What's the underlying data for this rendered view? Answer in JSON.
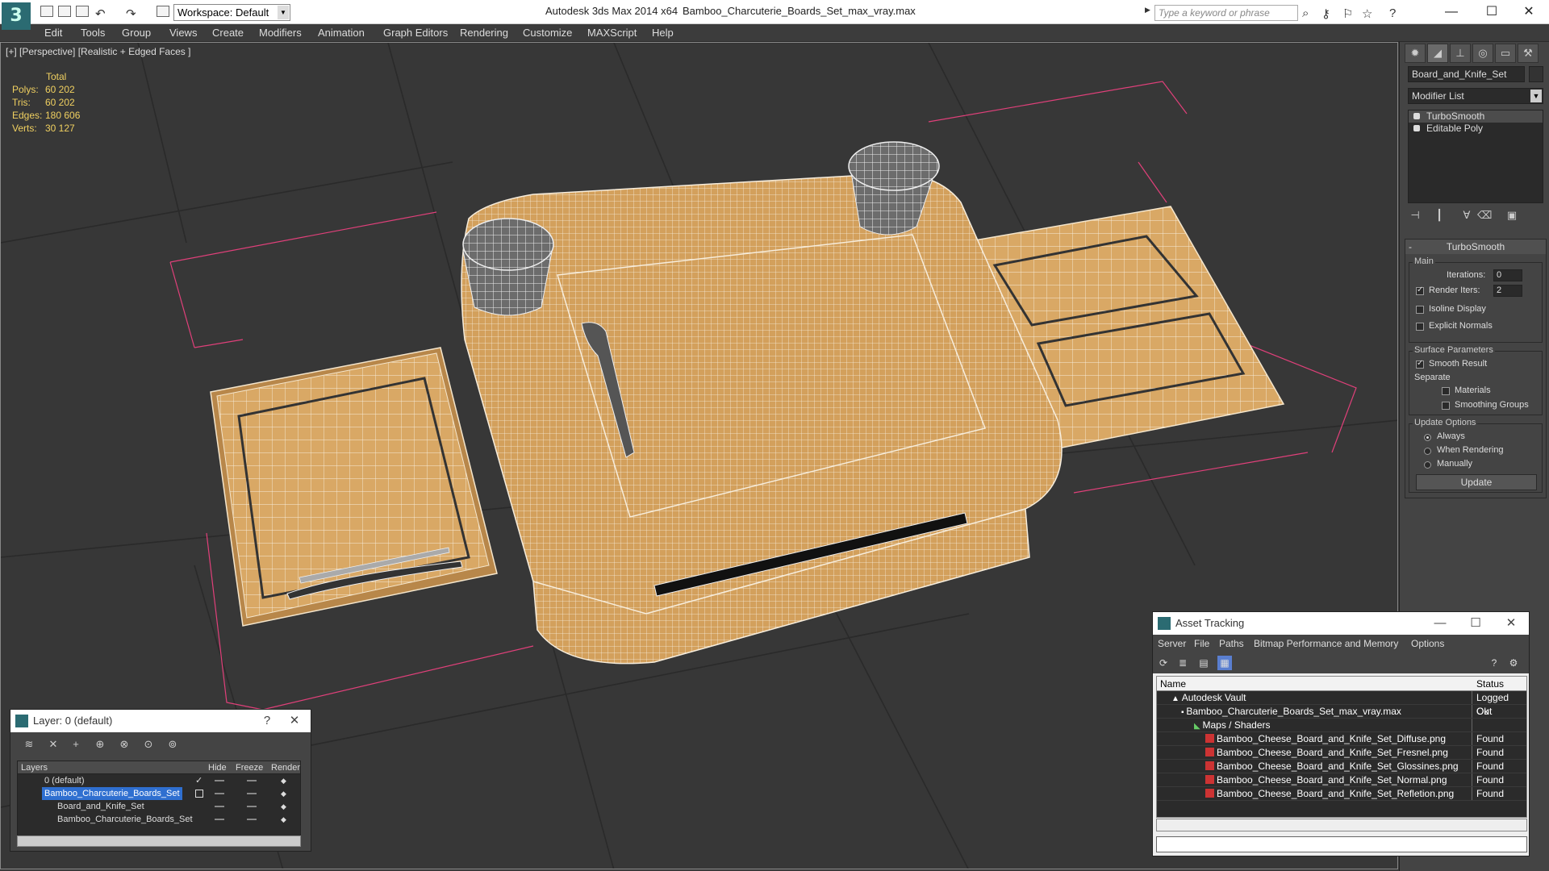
{
  "titlebar": {
    "workspace": "Workspace: Default",
    "app_title": "Autodesk 3ds Max  2014 x64",
    "file_title": "Bamboo_Charcuterie_Boards_Set_max_vray.max",
    "search_placeholder": "Type a keyword or phrase"
  },
  "menu": [
    "Edit",
    "Tools",
    "Group",
    "Views",
    "Create",
    "Modifiers",
    "Animation",
    "Graph Editors",
    "Rendering",
    "Customize",
    "MAXScript",
    "Help"
  ],
  "viewport": {
    "label": "[+] [Perspective] [Realistic + Edged Faces ]",
    "stats": {
      "header": "Total",
      "rows": [
        {
          "label": "Polys:",
          "value": "60 202"
        },
        {
          "label": "Tris:",
          "value": "60 202"
        },
        {
          "label": "Edges:",
          "value": "180 606"
        },
        {
          "label": "Verts:",
          "value": "30 127"
        }
      ]
    }
  },
  "command_panel": {
    "object_name": "Board_and_Knife_Set",
    "modifier_list": "Modifier List",
    "stack": [
      "TurboSmooth",
      "Editable Poly"
    ],
    "rollout_title": "TurboSmooth",
    "main_group": "Main",
    "iterations_label": "Iterations:",
    "iterations_value": "0",
    "render_iters_label": "Render Iters:",
    "render_iters_value": "2",
    "isoline": "Isoline Display",
    "explicit_normals": "Explicit Normals",
    "surface_group": "Surface Parameters",
    "smooth_result": "Smooth Result",
    "separate": "Separate",
    "materials": "Materials",
    "smoothing_groups": "Smoothing Groups",
    "update_group": "Update Options",
    "always": "Always",
    "when_rendering": "When Rendering",
    "manually": "Manually",
    "update_button": "Update"
  },
  "layer_window": {
    "title": "Layer: 0 (default)",
    "help": "?",
    "columns": [
      "Layers",
      "Hide",
      "Freeze",
      "Render"
    ],
    "rows": [
      {
        "name": "0 (default)"
      },
      {
        "name": "Bamboo_Charcuterie_Boards_Set"
      },
      {
        "name": "Board_and_Knife_Set"
      },
      {
        "name": "Bamboo_Charcuterie_Boards_Set"
      }
    ]
  },
  "asset_window": {
    "title": "Asset Tracking",
    "menu": [
      "Server",
      "File",
      "Paths",
      "Bitmap Performance and Memory",
      "Options"
    ],
    "columns": [
      "Name",
      "Status"
    ],
    "rows": [
      {
        "name": "Autodesk Vault",
        "status": "Logged Out"
      },
      {
        "name": "Bamboo_Charcuterie_Boards_Set_max_vray.max",
        "status": "Ok"
      },
      {
        "name": "Maps / Shaders",
        "status": ""
      },
      {
        "name": "Bamboo_Cheese_Board_and_Knife_Set_Diffuse.png",
        "status": "Found"
      },
      {
        "name": "Bamboo_Cheese_Board_and_Knife_Set_Fresnel.png",
        "status": "Found"
      },
      {
        "name": "Bamboo_Cheese_Board_and_Knife_Set_Glossines.png",
        "status": "Found"
      },
      {
        "name": "Bamboo_Cheese_Board_and_Knife_Set_Normal.png",
        "status": "Found"
      },
      {
        "name": "Bamboo_Cheese_Board_and_Knife_Set_Refletion.png",
        "status": "Found"
      }
    ]
  },
  "colors": {
    "wood": "#d7a560",
    "selection_box": "#e0407a",
    "stats_text": "#f0d060",
    "viewport_bg": "#373737"
  }
}
